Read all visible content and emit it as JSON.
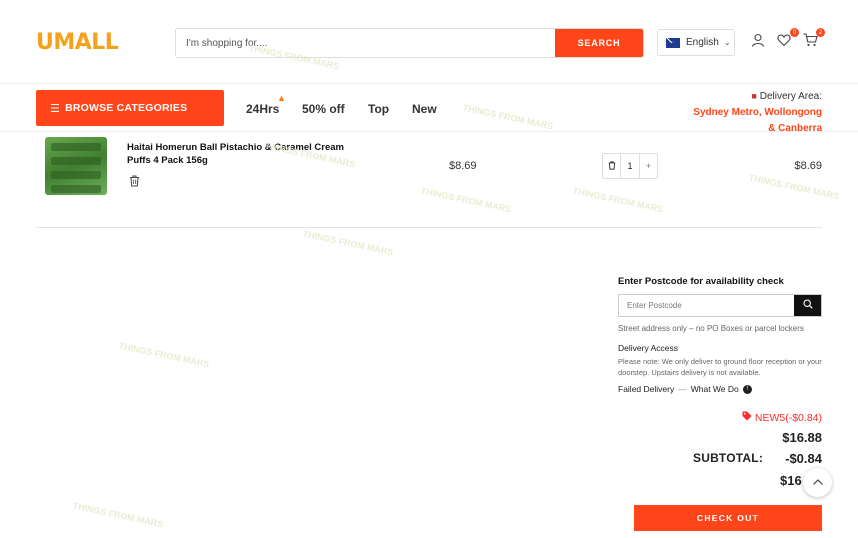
{
  "header": {
    "logo": "UMALL",
    "search_placeholder": "I'm shopping for....",
    "search_button": "SEARCH",
    "language": "English",
    "wishlist_count": "0",
    "cart_count": "2"
  },
  "nav": {
    "browse_label": "BROWSE CATEGORIES",
    "links": [
      "24Hrs",
      "50% off",
      "Top",
      "New"
    ],
    "delivery_label": "Delivery Area:",
    "delivery_area_line1": "Sydney Metro, Wollongong",
    "delivery_area_line2": "& Canberra"
  },
  "cart": {
    "item": {
      "name": "Haitai Homerun Ball Pistachio & Caramel Cream Puffs 4 Pack 156g",
      "price": "$8.69",
      "quantity": "1",
      "line_total": "$8.69"
    }
  },
  "postcode": {
    "title": "Enter Postcode for availability check",
    "placeholder": "Enter Postcode",
    "note": "Street address only – no PO Boxes or parcel lockers",
    "delivery_access_title": "Delivery Access",
    "delivery_access_text": "Please note: We only deliver to ground floor reception or your doorstep. Upstairs delivery is not available.",
    "failed_delivery": "Failed Delivery",
    "what_we_do": "What We Do"
  },
  "totals": {
    "coupon": "NEW5(-$0.84)",
    "total": "$16.88",
    "subtotal_label": "SUBTOTAL:",
    "discount": "-$0.84",
    "final_partial": "$16",
    "checkout_label": "CHECK OUT"
  },
  "watermark": "THINGS FROM MARS",
  "colors": {
    "accent": "#ff4519",
    "logo": "#f5a21b",
    "coupon": "#ff2a2a"
  },
  "icons": [
    "search-icon",
    "user-icon",
    "heart-icon",
    "cart-icon",
    "trash-icon",
    "fire-icon",
    "truck-icon",
    "tag-icon",
    "info-icon",
    "chevron-up-icon"
  ]
}
